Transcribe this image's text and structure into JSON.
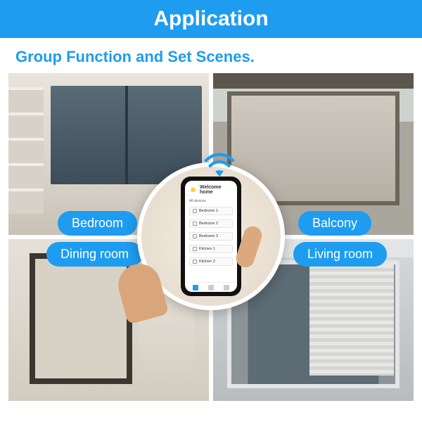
{
  "header": {
    "title": "Application"
  },
  "subtitle": "Group Function and Set Scenes.",
  "labels": {
    "bedroom": "Bedroom",
    "balcony": "Balcony",
    "dining": "Dining room",
    "living": "Living room"
  },
  "phone": {
    "welcome_title": "Welcome home",
    "section_label": "All devices",
    "devices": [
      {
        "name": "Bedroom 1"
      },
      {
        "name": "Bedroom 2"
      },
      {
        "name": "Bedroom 3"
      },
      {
        "name": "Kitchen 1"
      },
      {
        "name": "Kitchen 2"
      }
    ]
  }
}
